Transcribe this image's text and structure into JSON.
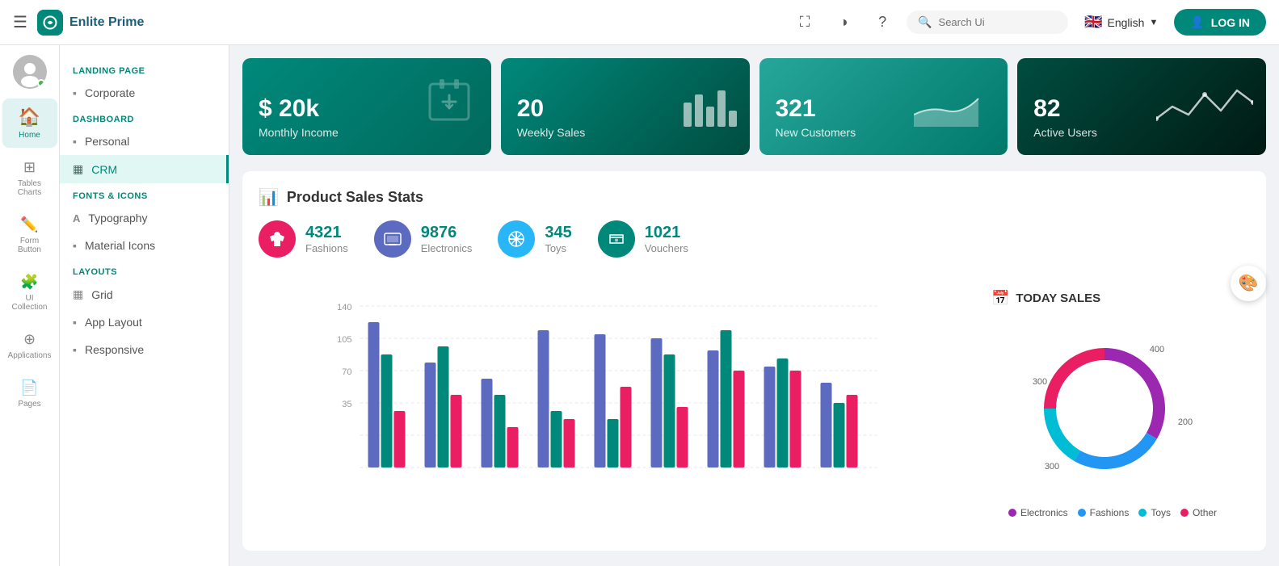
{
  "topnav": {
    "logo_text": "Enlite Prime",
    "logo_icon": "E",
    "search_placeholder": "Search Ui",
    "language": "English",
    "login_label": "LOG IN",
    "icons": [
      "fullscreen",
      "contrast",
      "help"
    ]
  },
  "icon_sidebar": {
    "items": [
      {
        "id": "home",
        "label": "Home",
        "icon": "🏠",
        "active": true
      },
      {
        "id": "tables-charts",
        "label": "Tables Charts",
        "icon": "⊞",
        "active": false
      },
      {
        "id": "form-button",
        "label": "Form Button",
        "icon": "✏️",
        "active": false
      },
      {
        "id": "ui-collection",
        "label": "UI Collection",
        "icon": "🧩",
        "active": false
      },
      {
        "id": "applications",
        "label": "Applications",
        "icon": "⊕",
        "active": false
      },
      {
        "id": "pages",
        "label": "Pages",
        "icon": "📄",
        "active": false
      }
    ]
  },
  "menu_sidebar": {
    "sections": [
      {
        "title": "LANDING PAGE",
        "items": [
          {
            "id": "corporate",
            "label": "Corporate",
            "icon": "▪",
            "active": false
          }
        ]
      },
      {
        "title": "DASHBOARD",
        "items": [
          {
            "id": "personal",
            "label": "Personal",
            "icon": "▪",
            "active": false
          },
          {
            "id": "crm",
            "label": "CRM",
            "icon": "▦",
            "active": true
          }
        ]
      },
      {
        "title": "FONTS & ICONS",
        "items": [
          {
            "id": "typography",
            "label": "Typography",
            "icon": "A",
            "active": false
          },
          {
            "id": "material-icons",
            "label": "Material Icons",
            "icon": "▪",
            "active": false
          }
        ]
      },
      {
        "title": "LAYOUTS",
        "items": [
          {
            "id": "grid",
            "label": "Grid",
            "icon": "▦",
            "active": false
          },
          {
            "id": "app-layout",
            "label": "App Layout",
            "icon": "▪",
            "active": false
          },
          {
            "id": "responsive",
            "label": "Responsive",
            "icon": "▪",
            "active": false
          }
        ]
      }
    ]
  },
  "stat_cards": [
    {
      "number": "$ 20k",
      "label": "Monthly Income",
      "icon": "📋"
    },
    {
      "number": "20",
      "label": "Weekly Sales",
      "icon": "bars"
    },
    {
      "number": "321",
      "label": "New Customers",
      "icon": "area"
    },
    {
      "number": "82",
      "label": "Active Users",
      "icon": "line"
    }
  ],
  "product_sales": {
    "title": "Product Sales Stats",
    "stats": [
      {
        "id": "fashions",
        "label": "Fashions",
        "value": "4321",
        "color": "#e91e63",
        "type": "fashion"
      },
      {
        "id": "electronics",
        "label": "Electronics",
        "value": "9876",
        "color": "#5c6bc0",
        "type": "electronics"
      },
      {
        "id": "toys",
        "label": "Toys",
        "value": "345",
        "color": "#29b6f6",
        "type": "toys"
      },
      {
        "id": "vouchers",
        "label": "Vouchers",
        "value": "1021",
        "color": "#00897b",
        "type": "vouchers"
      }
    ]
  },
  "bar_chart": {
    "y_labels": [
      "140",
      "105",
      "70",
      "35"
    ],
    "colors": {
      "blue": "#5c6bc0",
      "teal": "#00897b",
      "pink": "#e91e63"
    }
  },
  "donut_chart": {
    "title": "TODAY SALES",
    "segments": [
      {
        "label": "Electronics",
        "value": 400,
        "color": "#9c27b0"
      },
      {
        "label": "Fashions",
        "value": 300,
        "color": "#2196f3"
      },
      {
        "label": "Toys",
        "value": 200,
        "color": "#00bcd4"
      },
      {
        "label": "Other",
        "value": 300,
        "color": "#e91e63"
      }
    ],
    "labels": [
      "400",
      "300",
      "200",
      "300"
    ]
  }
}
